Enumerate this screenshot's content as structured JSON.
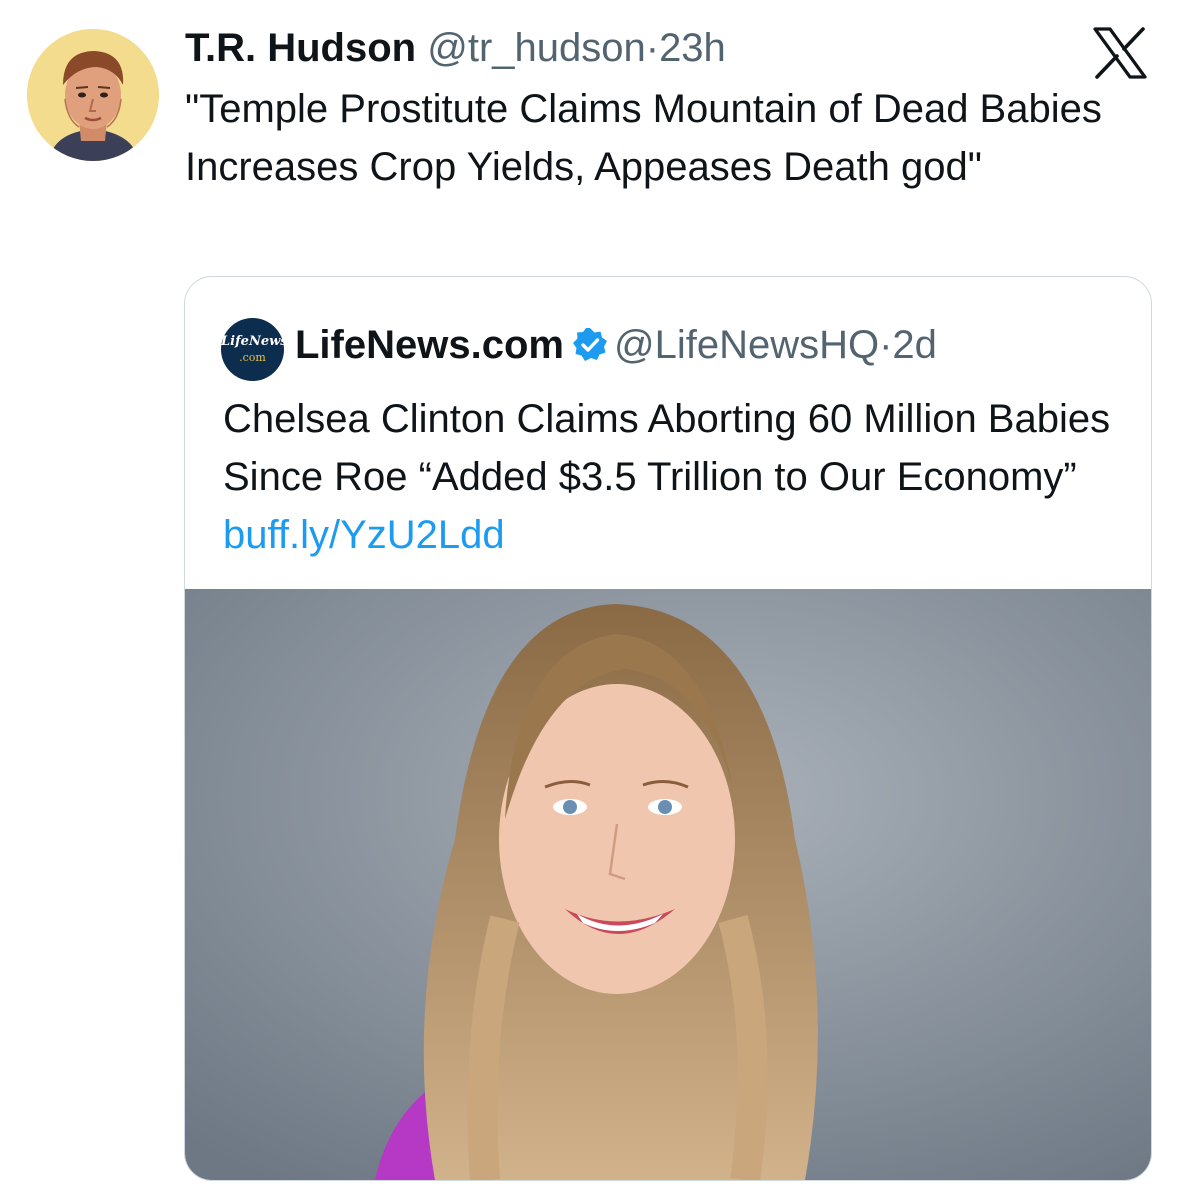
{
  "tweet": {
    "author_name": "T.R. Hudson",
    "handle": "@tr_hudson",
    "separator": "·",
    "time": "23h",
    "text": "\"Temple Prostitute Claims Mountain of Dead Babies Increases Crop Yields, Appeases Death god\"",
    "avatar_icon": "illustrated-man-portrait",
    "platform_icon": "x-logo-icon"
  },
  "quoted": {
    "avatar_line1": "LifeNews",
    "avatar_line2": ".com",
    "author_name": "LifeNews.com",
    "verified_icon": "verified-badge-icon",
    "handle": "@LifeNewsHQ",
    "separator": "·",
    "time": "2d",
    "text": "Chelsea Clinton Claims Aborting 60 Million Babies Since Roe “Added $3.5 Trillion to Our Economy”",
    "link": "buff.ly/YzU2Ldd",
    "image_icon": "woman-portrait-photo"
  },
  "colors": {
    "link": "#1d9bf0",
    "secondary_text": "#536471",
    "verified": "#1d9bf0",
    "border": "#cfd9de"
  }
}
